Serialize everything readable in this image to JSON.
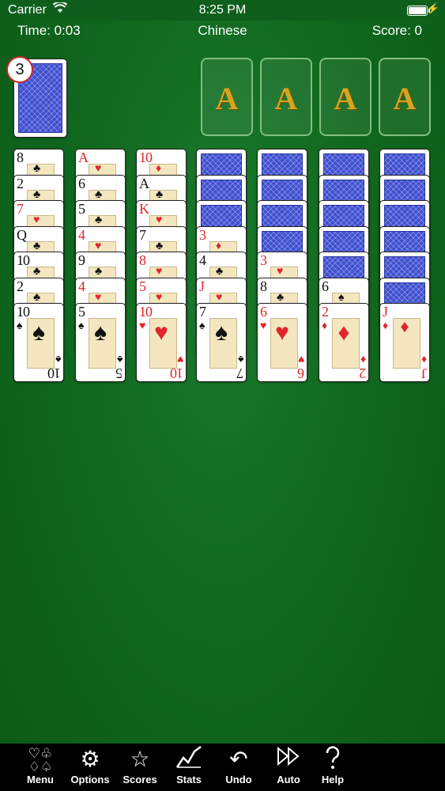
{
  "status": {
    "carrier": "Carrier",
    "time": "8:25 PM"
  },
  "header": {
    "time": "Time: 0:03",
    "game": "Chinese",
    "score": "Score: 0"
  },
  "stock": {
    "count": "3"
  },
  "foundations": [
    {
      "label": "A"
    },
    {
      "label": "A"
    },
    {
      "label": "A"
    },
    {
      "label": "A"
    }
  ],
  "colors": {
    "felt": "#11681f",
    "red_suit": "#e0262c",
    "card_back": "#3f4fd0",
    "foundation_ace": "#d6a520"
  },
  "tableau": [
    {
      "down": 0,
      "up": [
        {
          "rank": "8",
          "suit": "♣"
        },
        {
          "rank": "2",
          "suit": "♣"
        },
        {
          "rank": "7",
          "suit": "♥"
        },
        {
          "rank": "Q",
          "suit": "♣"
        },
        {
          "rank": "10",
          "suit": "♣"
        },
        {
          "rank": "2",
          "suit": "♣"
        },
        {
          "rank": "10",
          "suit": "♠"
        }
      ]
    },
    {
      "down": 0,
      "up": [
        {
          "rank": "A",
          "suit": "♥"
        },
        {
          "rank": "6",
          "suit": "♣"
        },
        {
          "rank": "5",
          "suit": "♣"
        },
        {
          "rank": "4",
          "suit": "♥"
        },
        {
          "rank": "9",
          "suit": "♣"
        },
        {
          "rank": "4",
          "suit": "♥"
        },
        {
          "rank": "5",
          "suit": "♠"
        }
      ]
    },
    {
      "down": 0,
      "up": [
        {
          "rank": "10",
          "suit": "♦"
        },
        {
          "rank": "A",
          "suit": "♣"
        },
        {
          "rank": "K",
          "suit": "♥"
        },
        {
          "rank": "7",
          "suit": "♣"
        },
        {
          "rank": "8",
          "suit": "♥"
        },
        {
          "rank": "5",
          "suit": "♥"
        },
        {
          "rank": "10",
          "suit": "♥"
        }
      ]
    },
    {
      "down": 3,
      "up": [
        {
          "rank": "3",
          "suit": "♦"
        },
        {
          "rank": "4",
          "suit": "♣"
        },
        {
          "rank": "J",
          "suit": "♥"
        },
        {
          "rank": "7",
          "suit": "♠"
        }
      ]
    },
    {
      "down": 4,
      "up": [
        {
          "rank": "3",
          "suit": "♥"
        },
        {
          "rank": "8",
          "suit": "♣"
        },
        {
          "rank": "6",
          "suit": "♥"
        }
      ]
    },
    {
      "down": 5,
      "up": [
        {
          "rank": "6",
          "suit": "♠"
        },
        {
          "rank": "2",
          "suit": "♦"
        }
      ]
    },
    {
      "down": 6,
      "up": [
        {
          "rank": "J",
          "suit": "♦"
        }
      ]
    }
  ],
  "toolbar": [
    {
      "label": "Menu",
      "icon": "suits-icon"
    },
    {
      "label": "Options",
      "icon": "gears-icon"
    },
    {
      "label": "Scores",
      "icon": "star-icon"
    },
    {
      "label": "Stats",
      "icon": "chart-icon"
    },
    {
      "label": "Undo",
      "icon": "undo-icon"
    },
    {
      "label": "Auto",
      "icon": "fast-forward-icon"
    },
    {
      "label": "Help",
      "icon": "help-icon"
    }
  ]
}
